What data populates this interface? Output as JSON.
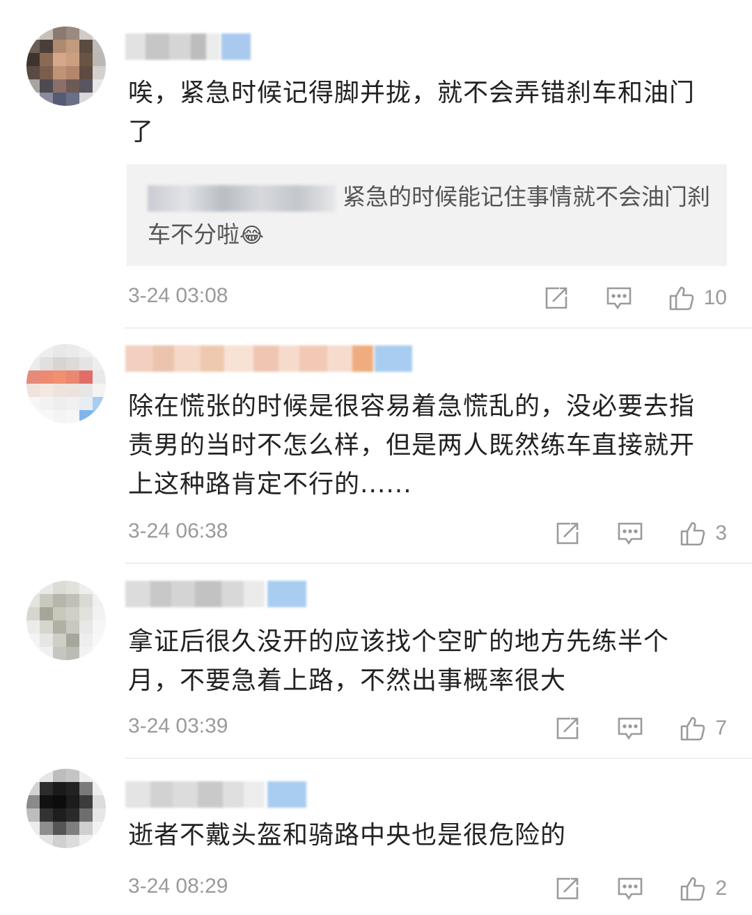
{
  "comments": [
    {
      "text": "唉，紧急时候记得脚并拢，就不会弄错刹车和油门了",
      "quote": {
        "text": "紧急的时候能记住事情就不会油门刹车不分啦",
        "emoji": "😂"
      },
      "time": "3-24 03:08",
      "likes": "10"
    },
    {
      "text": "除在慌张的时候是很容易着急慌乱的，没必要去指责男的当时不怎么样，但是两人既然练车直接就开上这种路肯定不行的......",
      "time": "3-24 06:38",
      "likes": "3"
    },
    {
      "text": "拿证后很久没开的应该找个空旷的地方先练半个月，不要急着上路，不然出事概率很大",
      "time": "3-24 03:39",
      "likes": "7"
    },
    {
      "text": "逝者不戴头盔和骑路中央也是很危险的",
      "time": "3-24 08:29",
      "likes": "2"
    }
  ],
  "icons": {
    "share": "share-icon",
    "reply": "comment-icon",
    "like": "thumbs-up-icon"
  }
}
